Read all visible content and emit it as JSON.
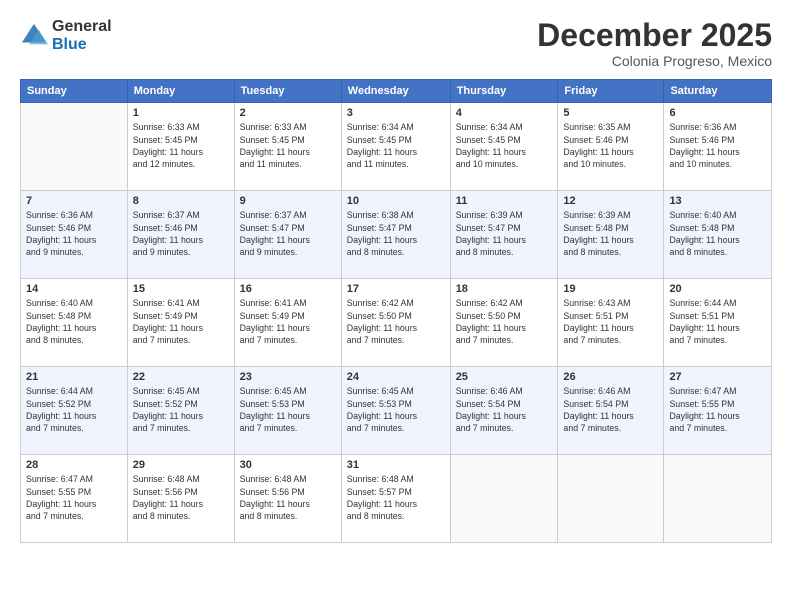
{
  "header": {
    "logo_general": "General",
    "logo_blue": "Blue",
    "month_title": "December 2025",
    "location": "Colonia Progreso, Mexico"
  },
  "calendar": {
    "days_of_week": [
      "Sunday",
      "Monday",
      "Tuesday",
      "Wednesday",
      "Thursday",
      "Friday",
      "Saturday"
    ],
    "weeks": [
      [
        {
          "day": "",
          "info": ""
        },
        {
          "day": "1",
          "info": "Sunrise: 6:33 AM\nSunset: 5:45 PM\nDaylight: 11 hours\nand 12 minutes."
        },
        {
          "day": "2",
          "info": "Sunrise: 6:33 AM\nSunset: 5:45 PM\nDaylight: 11 hours\nand 11 minutes."
        },
        {
          "day": "3",
          "info": "Sunrise: 6:34 AM\nSunset: 5:45 PM\nDaylight: 11 hours\nand 11 minutes."
        },
        {
          "day": "4",
          "info": "Sunrise: 6:34 AM\nSunset: 5:45 PM\nDaylight: 11 hours\nand 10 minutes."
        },
        {
          "day": "5",
          "info": "Sunrise: 6:35 AM\nSunset: 5:46 PM\nDaylight: 11 hours\nand 10 minutes."
        },
        {
          "day": "6",
          "info": "Sunrise: 6:36 AM\nSunset: 5:46 PM\nDaylight: 11 hours\nand 10 minutes."
        }
      ],
      [
        {
          "day": "7",
          "info": "Sunrise: 6:36 AM\nSunset: 5:46 PM\nDaylight: 11 hours\nand 9 minutes."
        },
        {
          "day": "8",
          "info": "Sunrise: 6:37 AM\nSunset: 5:46 PM\nDaylight: 11 hours\nand 9 minutes."
        },
        {
          "day": "9",
          "info": "Sunrise: 6:37 AM\nSunset: 5:47 PM\nDaylight: 11 hours\nand 9 minutes."
        },
        {
          "day": "10",
          "info": "Sunrise: 6:38 AM\nSunset: 5:47 PM\nDaylight: 11 hours\nand 8 minutes."
        },
        {
          "day": "11",
          "info": "Sunrise: 6:39 AM\nSunset: 5:47 PM\nDaylight: 11 hours\nand 8 minutes."
        },
        {
          "day": "12",
          "info": "Sunrise: 6:39 AM\nSunset: 5:48 PM\nDaylight: 11 hours\nand 8 minutes."
        },
        {
          "day": "13",
          "info": "Sunrise: 6:40 AM\nSunset: 5:48 PM\nDaylight: 11 hours\nand 8 minutes."
        }
      ],
      [
        {
          "day": "14",
          "info": "Sunrise: 6:40 AM\nSunset: 5:48 PM\nDaylight: 11 hours\nand 8 minutes."
        },
        {
          "day": "15",
          "info": "Sunrise: 6:41 AM\nSunset: 5:49 PM\nDaylight: 11 hours\nand 7 minutes."
        },
        {
          "day": "16",
          "info": "Sunrise: 6:41 AM\nSunset: 5:49 PM\nDaylight: 11 hours\nand 7 minutes."
        },
        {
          "day": "17",
          "info": "Sunrise: 6:42 AM\nSunset: 5:50 PM\nDaylight: 11 hours\nand 7 minutes."
        },
        {
          "day": "18",
          "info": "Sunrise: 6:42 AM\nSunset: 5:50 PM\nDaylight: 11 hours\nand 7 minutes."
        },
        {
          "day": "19",
          "info": "Sunrise: 6:43 AM\nSunset: 5:51 PM\nDaylight: 11 hours\nand 7 minutes."
        },
        {
          "day": "20",
          "info": "Sunrise: 6:44 AM\nSunset: 5:51 PM\nDaylight: 11 hours\nand 7 minutes."
        }
      ],
      [
        {
          "day": "21",
          "info": "Sunrise: 6:44 AM\nSunset: 5:52 PM\nDaylight: 11 hours\nand 7 minutes."
        },
        {
          "day": "22",
          "info": "Sunrise: 6:45 AM\nSunset: 5:52 PM\nDaylight: 11 hours\nand 7 minutes."
        },
        {
          "day": "23",
          "info": "Sunrise: 6:45 AM\nSunset: 5:53 PM\nDaylight: 11 hours\nand 7 minutes."
        },
        {
          "day": "24",
          "info": "Sunrise: 6:45 AM\nSunset: 5:53 PM\nDaylight: 11 hours\nand 7 minutes."
        },
        {
          "day": "25",
          "info": "Sunrise: 6:46 AM\nSunset: 5:54 PM\nDaylight: 11 hours\nand 7 minutes."
        },
        {
          "day": "26",
          "info": "Sunrise: 6:46 AM\nSunset: 5:54 PM\nDaylight: 11 hours\nand 7 minutes."
        },
        {
          "day": "27",
          "info": "Sunrise: 6:47 AM\nSunset: 5:55 PM\nDaylight: 11 hours\nand 7 minutes."
        }
      ],
      [
        {
          "day": "28",
          "info": "Sunrise: 6:47 AM\nSunset: 5:55 PM\nDaylight: 11 hours\nand 7 minutes."
        },
        {
          "day": "29",
          "info": "Sunrise: 6:48 AM\nSunset: 5:56 PM\nDaylight: 11 hours\nand 8 minutes."
        },
        {
          "day": "30",
          "info": "Sunrise: 6:48 AM\nSunset: 5:56 PM\nDaylight: 11 hours\nand 8 minutes."
        },
        {
          "day": "31",
          "info": "Sunrise: 6:48 AM\nSunset: 5:57 PM\nDaylight: 11 hours\nand 8 minutes."
        },
        {
          "day": "",
          "info": ""
        },
        {
          "day": "",
          "info": ""
        },
        {
          "day": "",
          "info": ""
        }
      ]
    ]
  }
}
